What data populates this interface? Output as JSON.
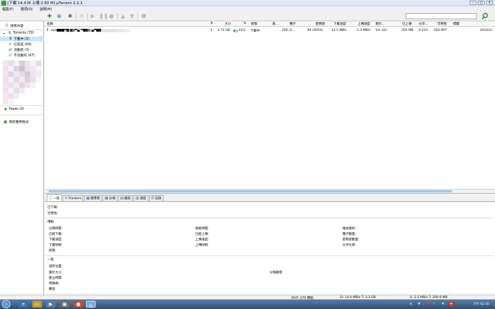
{
  "window": {
    "title": "[下載 14.4 M 上傳 2.50 M] µTorrent 2.2.1",
    "minimize": "─",
    "maximize": "□",
    "close": "✕"
  },
  "menu": [
    "檔案(F)",
    "選項(O)",
    "說明(H)"
  ],
  "toolbar": {
    "search_placeholder": ""
  },
  "sidebar": {
    "search_label": "搜尋內容",
    "torrents_label": "Torrents (70)",
    "items": [
      {
        "label": "下載中 (1)"
      },
      {
        "label": "已完成 (69)"
      },
      {
        "label": "活動的 (3)"
      },
      {
        "label": "不活動的 (67)"
      }
    ],
    "feeds_label": "Feeds (0)",
    "apps_label": "我的應用程式"
  },
  "columns": [
    "名稱",
    "#",
    "大小",
    "%",
    "狀態",
    "來...",
    "種子",
    "使用者",
    "下載速度",
    "上傳速度",
    "預計...",
    "已上傳",
    "分享...",
    "可用性",
    "標籤",
    ""
  ],
  "torrent": {
    "name": "Spa███▀█ ▓▒▀▄ ▀█▓▒ ▄▀█▓",
    "num": "1",
    "size": "3.73 GB",
    "percent": "41%",
    "progress": 0.41,
    "status": "下載中",
    "source": "",
    "seeds": "256 (2...",
    "peers": "44 (4053)",
    "down_speed": "14.5 MB/s",
    "up_speed": "2.3 MB/s",
    "eta": "1m 32s",
    "uploaded": "201 MB",
    "ratio": "0.154",
    "availability": "262.997",
    "added": "2014/2/"
  },
  "tabs": [
    {
      "label": "一般",
      "icon": "info-icon"
    },
    {
      "label": "Trackers",
      "icon": "tracker-icon"
    },
    {
      "label": "使用者",
      "icon": "peers-icon"
    },
    {
      "label": "分塊",
      "icon": "pieces-icon"
    },
    {
      "label": "檔案",
      "icon": "files-icon"
    },
    {
      "label": "速度",
      "icon": "speed-icon"
    },
    {
      "label": "記錄",
      "icon": "log-icon"
    }
  ],
  "detail": {
    "downloaded": "已下載:",
    "availability": "可用性:",
    "transfer_header": "傳輸",
    "transfer": [
      [
        "已用時間:",
        "剩餘時間:",
        "傳承資料:"
      ],
      [
        "已經下載:",
        "已經上傳:",
        "種子數量:"
      ],
      [
        "下載速度:",
        "上傳速度:",
        "使用者數量:"
      ],
      [
        "下載限制:",
        "上傳限制:",
        "分享比率:"
      ],
      [
        "狀態:",
        "",
        ""
      ]
    ],
    "general_header": "一般",
    "general": [
      "儲存位置:",
      "總計大小:",
      "建立時間:",
      "特殊碼:",
      "備註:"
    ],
    "pieces_label": "分塊數量:"
  },
  "statusbar": {
    "dht": "DHT: 270 節點",
    "download": "D: 14.4 MB/s T: 3.3 GB",
    "upload": "U: 2.5 MB/s T: 200.9 MB"
  },
  "taskbar": {
    "ime": "中",
    "time": "下午 02:30"
  }
}
